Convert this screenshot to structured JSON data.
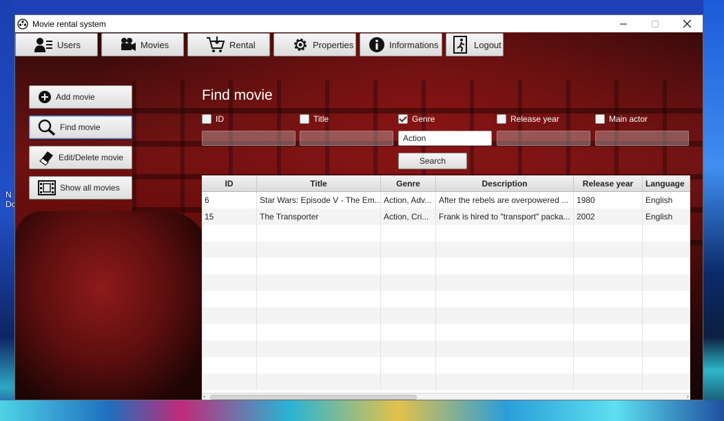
{
  "window": {
    "title": "Movie rental system"
  },
  "desktop": {
    "fragment_lines": [
      "N",
      "Do"
    ]
  },
  "nav": {
    "users": "Users",
    "movies": "Movies",
    "rental": "Rental",
    "properties": "Properties",
    "informations": "Informations",
    "logout": "Logout"
  },
  "sidebar": {
    "add_movie": "Add movie",
    "find_movie": "Find movie",
    "edit_delete": "Edit/Delete movie",
    "show_all": "Show all movies"
  },
  "find": {
    "heading": "Find movie",
    "criteria": [
      {
        "label": "ID",
        "checked": false,
        "value": ""
      },
      {
        "label": "Title",
        "checked": false,
        "value": ""
      },
      {
        "label": "Genre",
        "checked": true,
        "value": "Action"
      },
      {
        "label": "Release year",
        "checked": false,
        "value": ""
      },
      {
        "label": "Main actor",
        "checked": false,
        "value": ""
      }
    ],
    "search_label": "Search"
  },
  "table": {
    "columns": [
      "ID",
      "Title",
      "Genre",
      "Description",
      "Release year",
      "Language"
    ],
    "rows": [
      [
        "6",
        "Star Wars: Episode V - The Em...",
        "Action, Adv...",
        "After the rebels are overpowered ...",
        "1980",
        "English"
      ],
      [
        "15",
        "The Transporter",
        "Action, Cri...",
        "Frank is hired to \"transport\" packa...",
        "2002",
        "English"
      ]
    ]
  }
}
